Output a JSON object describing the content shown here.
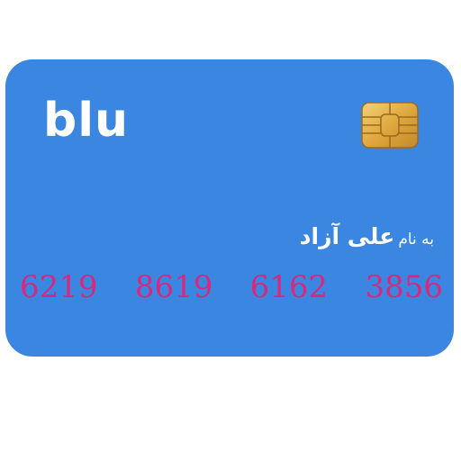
{
  "card": {
    "brand_logo": "blu",
    "holder_prefix": "به نام",
    "holder_name": "علی آزاد",
    "number_groups": [
      "6219",
      "8619",
      "6162",
      "3856"
    ],
    "colors": {
      "card_background": "#3a86e0",
      "number_text": "#d8287e",
      "chip_gold": "#e4b24c"
    }
  },
  "icons": {
    "chip": "emv-chip-icon"
  }
}
